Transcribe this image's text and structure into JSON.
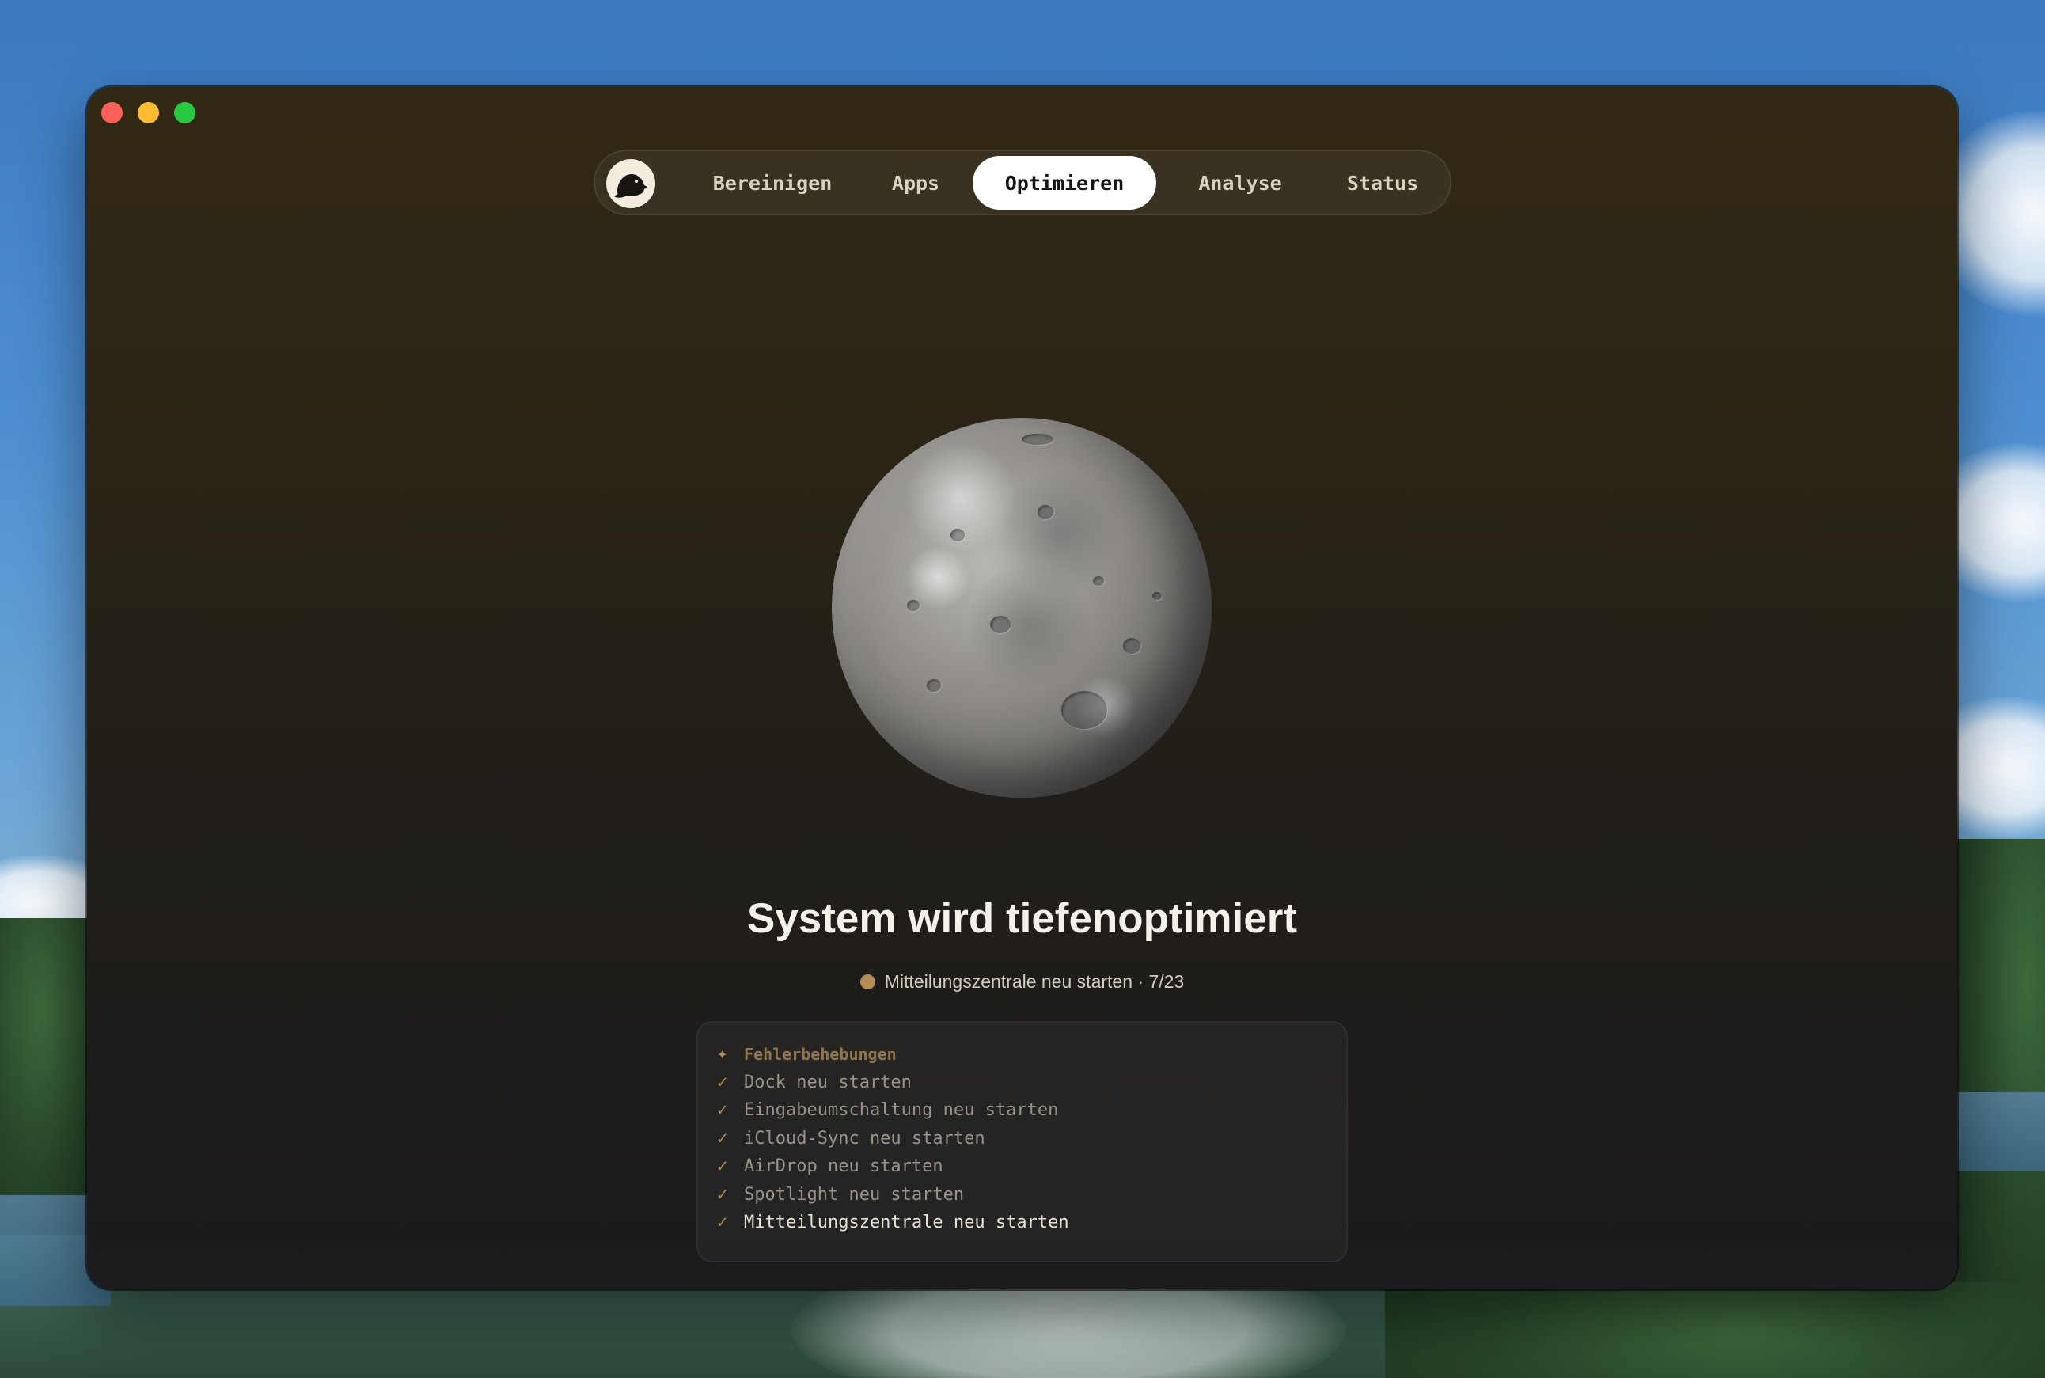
{
  "window": {
    "controls": [
      "close",
      "minimize",
      "maximize"
    ]
  },
  "nav": {
    "logo_icon": "beaver-logo-icon",
    "tabs": [
      {
        "label": "Bereinigen",
        "active": false
      },
      {
        "label": "Apps",
        "active": false
      },
      {
        "label": "Optimieren",
        "active": true
      },
      {
        "label": "Analyse",
        "active": false
      },
      {
        "label": "Status",
        "active": false
      }
    ]
  },
  "main": {
    "illustration": "moon-planet-image",
    "title": "System wird tiefenoptimiert",
    "status": {
      "current_task": "Mitteilungszentrale neu starten",
      "separator": " · ",
      "progress": "7/23",
      "dot_color": "#b48d52"
    }
  },
  "tasks": {
    "header_icon": "sparkle-icon",
    "header": "Fehlerbehebungen",
    "item_icon": "checkmark-icon",
    "items": [
      "Dock neu starten",
      "Eingabeumschaltung neu starten",
      "iCloud-Sync neu starten",
      "AirDrop neu starten",
      "Spotlight neu starten",
      "Mitteilungszentrale neu starten"
    ]
  },
  "colors": {
    "accent": "#b48d52",
    "active_tab_bg": "#ffffff",
    "window_bg_top": "#322914",
    "window_bg_bottom": "#1c1b1d"
  }
}
